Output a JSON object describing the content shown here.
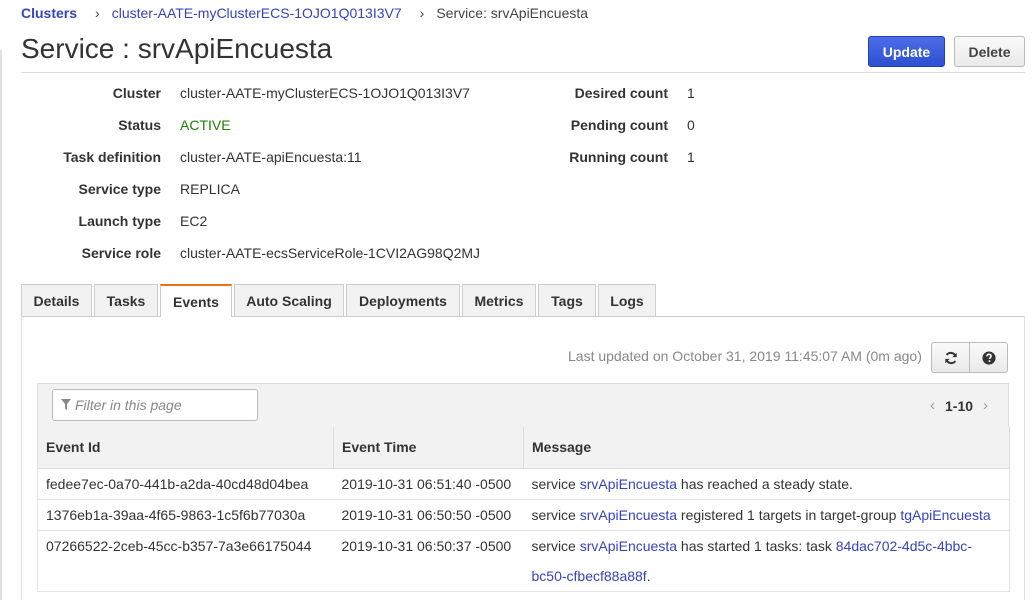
{
  "breadcrumb": {
    "root": "Clusters",
    "cluster": "cluster-AATE-myClusterECS-1OJO1Q013I3V7",
    "current": "Service: srvApiEncuesta"
  },
  "page": {
    "title": "Service : srvApiEncuesta"
  },
  "actions": {
    "update": "Update",
    "delete": "Delete"
  },
  "summary": {
    "cluster_label": "Cluster",
    "cluster_value": "cluster-AATE-myClusterECS-1OJO1Q013I3V7",
    "status_label": "Status",
    "status_value": "ACTIVE",
    "task_def_label": "Task definition",
    "task_def_value": "cluster-AATE-apiEncuesta:11",
    "service_type_label": "Service type",
    "service_type_value": "REPLICA",
    "launch_type_label": "Launch type",
    "launch_type_value": "EC2",
    "service_role_label": "Service role",
    "service_role_value": "cluster-AATE-ecsServiceRole-1CVI2AG98Q2MJ",
    "desired_label": "Desired count",
    "desired_value": "1",
    "pending_label": "Pending count",
    "pending_value": "0",
    "running_label": "Running count",
    "running_value": "1"
  },
  "tabs": [
    {
      "label": "Details"
    },
    {
      "label": "Tasks"
    },
    {
      "label": "Events",
      "active": true
    },
    {
      "label": "Auto Scaling"
    },
    {
      "label": "Deployments"
    },
    {
      "label": "Metrics"
    },
    {
      "label": "Tags"
    },
    {
      "label": "Logs"
    }
  ],
  "events": {
    "last_updated": "Last updated on October 31, 2019 11:45:07 AM (0m ago)",
    "filter_placeholder": "Filter in this page",
    "pager_range": "1-10",
    "columns": [
      "Event Id",
      "Event Time",
      "Message"
    ],
    "rows": [
      {
        "id": "fedee7ec-0a70-441b-a2da-40cd48d04bea",
        "time": "2019-10-31 06:51:40 -0500",
        "msg_prefix": "service ",
        "msg_link1": "srvApiEncuesta",
        "msg_mid": " has reached a steady state.",
        "msg_link2": ""
      },
      {
        "id": "1376eb1a-39aa-4f65-9863-1c5f6b77030a",
        "time": "2019-10-31 06:50:50 -0500",
        "msg_prefix": "service ",
        "msg_link1": "srvApiEncuesta",
        "msg_mid": " registered 1 targets in target-group ",
        "msg_link2": "tgApiEncuesta"
      },
      {
        "id": "07266522-2ceb-45cc-b357-7a3e66175044",
        "time": "2019-10-31 06:50:37 -0500",
        "msg_prefix": "service ",
        "msg_link1": "srvApiEncuesta",
        "msg_mid": " has started 1 tasks: task ",
        "msg_link2": "84dac702-4d5c-4bbc-bc50-cfbecf88a88f",
        "msg_suffix": "."
      }
    ]
  },
  "icons": {
    "refresh": "refresh-icon",
    "help": "help-icon",
    "filter": "filter-icon"
  }
}
